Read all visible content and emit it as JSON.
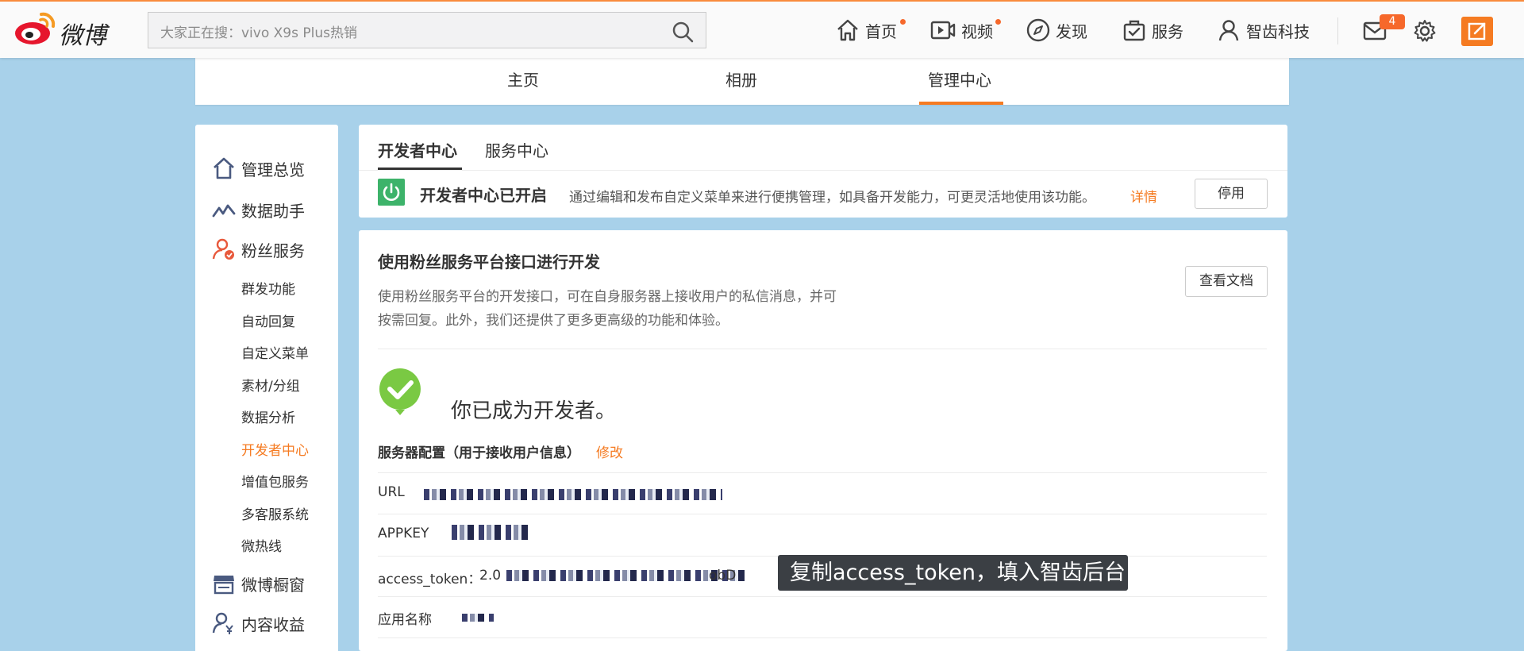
{
  "header": {
    "logo_text": "微博",
    "search_placeholder": "大家正在搜：vivo X9s Plus热销",
    "nav": [
      {
        "label": "首页",
        "icon": "home-icon"
      },
      {
        "label": "视频",
        "icon": "video-icon"
      },
      {
        "label": "发现",
        "icon": "compass-icon"
      },
      {
        "label": "服务",
        "icon": "briefcase-icon"
      },
      {
        "label": "智齿科技",
        "icon": "user-icon"
      }
    ],
    "mail_badge": "4"
  },
  "subnav": {
    "items": [
      "主页",
      "相册",
      "管理中心"
    ],
    "active": "管理中心"
  },
  "sidebar": {
    "top": [
      {
        "label": "管理总览",
        "icon": "home-icon"
      },
      {
        "label": "数据助手",
        "icon": "chart-line-icon"
      },
      {
        "label": "粉丝服务",
        "icon": "fans-icon"
      }
    ],
    "sub": [
      "群发功能",
      "自动回复",
      "自定义菜单",
      "素材/分组",
      "数据分析",
      "开发者中心",
      "增值包服务",
      "多客服系统",
      "微热线"
    ],
    "active": "开发者中心",
    "bottom": [
      {
        "label": "微博橱窗",
        "icon": "shop-icon"
      },
      {
        "label": "内容收益",
        "icon": "income-icon"
      }
    ]
  },
  "developer_card": {
    "tabs": [
      "开发者中心",
      "服务中心"
    ],
    "status_title": "开发者中心已开启",
    "status_desc": "通过编辑和发布自定义菜单来进行便携管理，如具备开发能力，可更灵活地使用该功能。",
    "details_link": "详情",
    "disable_button": "停用"
  },
  "api_card": {
    "title": "使用粉丝服务平台接口进行开发",
    "desc_line1": "使用粉丝服务平台的开发接口，可在自身服务器上接收用户的私信消息，并可",
    "desc_line2": "按需回复。此外，我们还提供了更多更高级的功能和体验。",
    "docs_button": "查看文档",
    "developer_message": "你已成为开发者。",
    "server_config_title": "服务器配置（用于接收用户信息）",
    "server_config_edit": "修改",
    "rows": {
      "url_label": "URL",
      "appkey_label": "APPKEY",
      "token_label": "access_token：",
      "token_prefix": "2.0",
      "token_suffix": "obD",
      "appname_label": "应用名称"
    },
    "tooltip": "复制access_token，填入智齿后台"
  },
  "colors": {
    "accent": "#f57b22",
    "background": "#a8d1ea",
    "success": "#7ac943",
    "power": "#3db36a"
  }
}
